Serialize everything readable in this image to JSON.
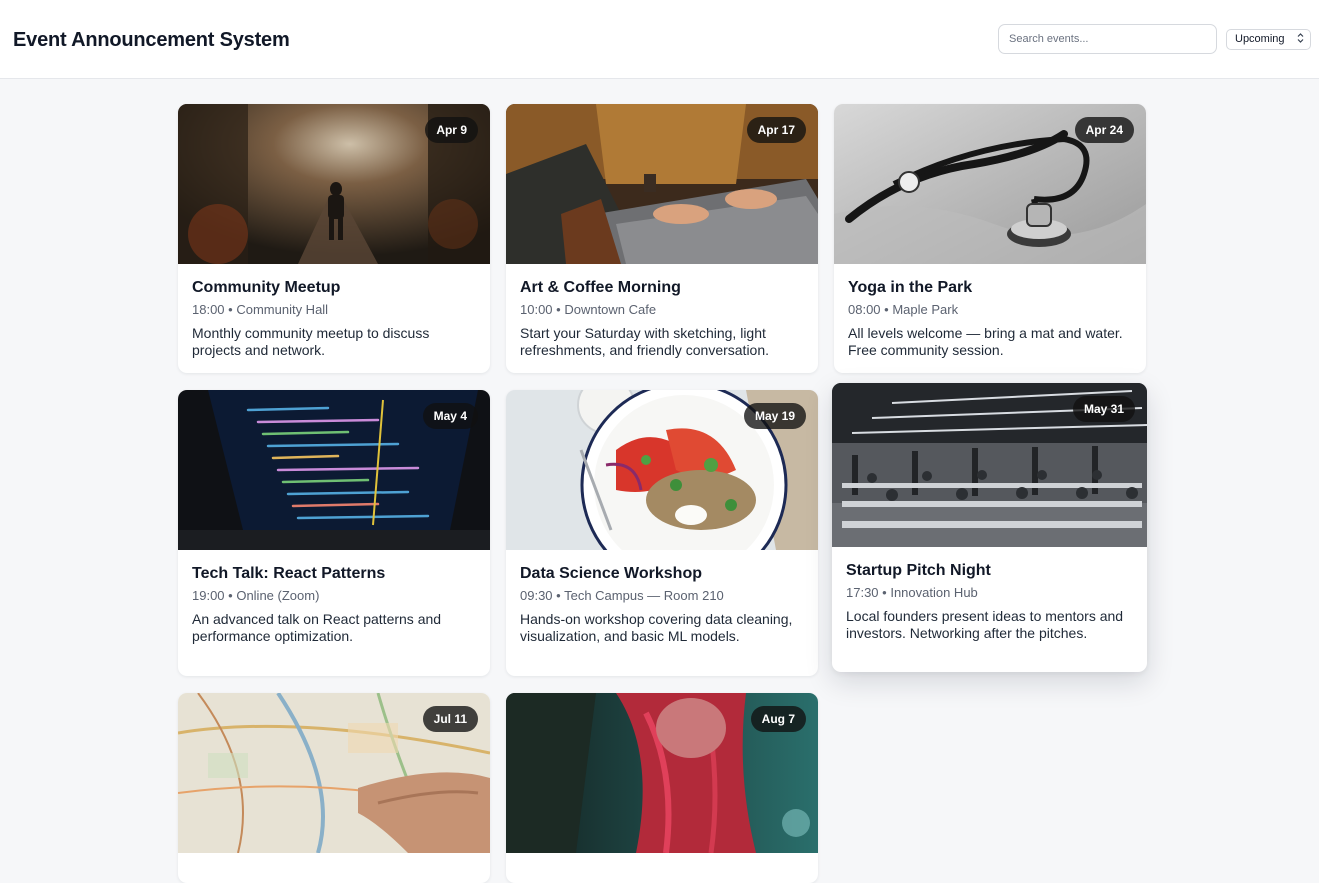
{
  "header": {
    "title": "Event Announcement System",
    "search_placeholder": "Search events...",
    "sort_value": "Upcoming"
  },
  "events": [
    {
      "date": "Apr 9",
      "title": "Community Meetup",
      "time": "18:00",
      "location": "Community Hall",
      "description": "Monthly community meetup to discuss projects and network.",
      "image": "forest-path-photo"
    },
    {
      "date": "Apr 17",
      "title": "Art & Coffee Morning",
      "time": "10:00",
      "location": "Downtown Cafe",
      "description": "Start your Saturday with sketching, light refreshments, and friendly conversation.",
      "image": "laptop-typing-photo"
    },
    {
      "date": "Apr 24",
      "title": "Yoga in the Park",
      "time": "08:00",
      "location": "Maple Park",
      "description": "All levels welcome — bring a mat and water. Free community session.",
      "image": "stethoscope-photo"
    },
    {
      "date": "May 4",
      "title": "Tech Talk: React Patterns",
      "time": "19:00",
      "location": "Online (Zoom)",
      "description": "An advanced talk on React patterns and performance optimization.",
      "image": "code-laptop-photo"
    },
    {
      "date": "May 19",
      "title": "Data Science Workshop",
      "time": "09:30",
      "location": "Tech Campus — Room 210",
      "description": "Hands-on workshop covering data cleaning, visualization, and basic ML models.",
      "image": "salad-plate-photo"
    },
    {
      "date": "May 31",
      "title": "Startup Pitch Night",
      "time": "17:30",
      "location": "Innovation Hub",
      "description": "Local founders present ideas to mentors and investors. Networking after the pitches.",
      "image": "open-office-photo"
    },
    {
      "date": "Jul 11",
      "title": "",
      "time": "",
      "location": "",
      "description": "",
      "image": "paper-map-photo"
    },
    {
      "date": "Aug 7",
      "title": "",
      "time": "",
      "location": "",
      "description": "",
      "image": "red-hair-photo"
    }
  ]
}
